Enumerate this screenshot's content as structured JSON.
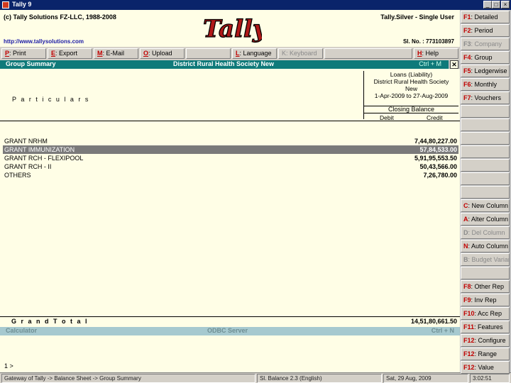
{
  "window": {
    "title": "Tally 9"
  },
  "header": {
    "copyright": "(c) Tally Solutions FZ-LLC, 1988-2008",
    "url": "http://www.tallysolutions.com",
    "product": "Tally.Silver - Single User",
    "serial": "Sl. No. : 773103897",
    "logo_text": "Tally"
  },
  "menu": [
    {
      "key": "P",
      "label": ": Print",
      "enabled": true
    },
    {
      "key": "E",
      "label": ": Export",
      "enabled": true
    },
    {
      "key": "M",
      "label": ": E-Mail",
      "enabled": true
    },
    {
      "key": "O",
      "label": ": Upload",
      "enabled": true
    },
    {
      "key": "",
      "label": "",
      "enabled": true
    },
    {
      "key": "L",
      "label": ": Language",
      "enabled": true
    },
    {
      "key": "K",
      "label": ": Keyboard",
      "enabled": false
    },
    {
      "key": "",
      "label": "",
      "enabled": true
    },
    {
      "key": "H",
      "label": ": Help",
      "enabled": true
    }
  ],
  "report": {
    "title": "Group Summary",
    "company": "District Rural Health Society New",
    "shortcut": "Ctrl + M",
    "close_symbol": "✕",
    "particulars_label": "P a r t i c u l a r s",
    "column_header": {
      "line1": "Loans (Liability)",
      "line2": "District Rural Health Society",
      "line3": "New",
      "period": "1-Apr-2009 to 27-Aug-2009",
      "closing_balance": "Closing Balance",
      "debit": "Debit",
      "credit": "Credit"
    },
    "rows": [
      {
        "name": "GRANT NRHM",
        "amount": "7,44,80,227.00",
        "selected": false
      },
      {
        "name": "GRANT IMMUNIZATION",
        "amount": "57,84,533.00",
        "selected": true
      },
      {
        "name": "GRANT RCH - FLEXIPOOL",
        "amount": "5,91,95,553.50",
        "selected": false
      },
      {
        "name": "GRANT RCH - II",
        "amount": "50,43,566.00",
        "selected": false
      },
      {
        "name": "OTHERS",
        "amount": "7,26,780.00",
        "selected": false
      }
    ],
    "grand_total_label": "G r a n d   T o t a l",
    "grand_total": "14,51,80,661.50"
  },
  "calculator": {
    "label": "Calculator",
    "odbc": "ODBC Server",
    "shortcut": "Ctrl + N",
    "cursor": "1 >"
  },
  "status": [
    "Gateway of Tally -> Balance Sheet -> Group Summary",
    "Sl. Balance 2.3 (English)",
    "Sat, 29 Aug, 2009",
    "3:02:51"
  ],
  "sidebar": [
    {
      "key": "F1",
      "label": ": Detailed",
      "enabled": true
    },
    {
      "key": "F2",
      "label": ": Period",
      "enabled": true
    },
    {
      "key": "F3",
      "label": ": Company",
      "enabled": false
    },
    {
      "key": "F4",
      "label": ": Group",
      "enabled": true
    },
    {
      "key": "F5",
      "label": ": Ledgerwise",
      "enabled": true
    },
    {
      "key": "F6",
      "label": ": Monthly",
      "enabled": true
    },
    {
      "key": "F7",
      "label": ": Vouchers",
      "enabled": true
    },
    {
      "key": "",
      "label": "",
      "enabled": true
    },
    {
      "key": "",
      "label": "",
      "enabled": true
    },
    {
      "key": "",
      "label": "",
      "enabled": true
    },
    {
      "key": "",
      "label": "",
      "enabled": true
    },
    {
      "key": "",
      "label": "",
      "enabled": true
    },
    {
      "key": "",
      "label": "",
      "enabled": true
    },
    {
      "key": "",
      "label": "",
      "enabled": true
    },
    {
      "key": "C",
      "label": ": New Column",
      "enabled": true
    },
    {
      "key": "A",
      "label": ": Alter Column",
      "enabled": true
    },
    {
      "key": "D",
      "label": ": Del Column",
      "enabled": false
    },
    {
      "key": "N",
      "label": ": Auto Column",
      "enabled": true
    },
    {
      "key": "B",
      "label": ": Budget Variance",
      "enabled": false
    },
    {
      "key": "",
      "label": "",
      "enabled": true
    },
    {
      "key": "F8",
      "label": ": Other Rep",
      "enabled": true
    },
    {
      "key": "F9",
      "label": ": Inv Rep",
      "enabled": true
    },
    {
      "key": "F10",
      "label": ": Acc Rep",
      "enabled": true
    },
    {
      "key": "F11",
      "label": ": Features",
      "enabled": true
    },
    {
      "key": "F12",
      "label": ": Configure",
      "enabled": true
    },
    {
      "key": "F12",
      "label": ": Range",
      "enabled": true
    },
    {
      "key": "F12",
      "label": ": Value",
      "enabled": true
    }
  ]
}
